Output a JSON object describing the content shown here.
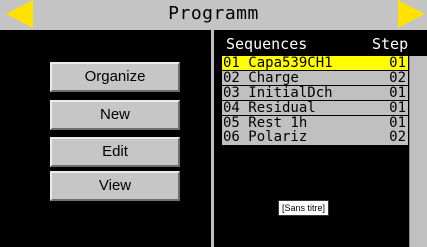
{
  "titlebar": {
    "title": "Programm",
    "prev_icon": "triangle-left-icon",
    "next_icon": "triangle-right-icon",
    "accent_color": "#ffe200"
  },
  "menu": {
    "organize_label": "Organize",
    "new_label": "New",
    "edit_label": "Edit",
    "view_label": "View"
  },
  "sequences": {
    "header_sequences": "Sequences",
    "header_step": "Step",
    "selected_color": "#ffff00",
    "rows": [
      {
        "label": "01 Capa539CH1",
        "step": "01"
      },
      {
        "label": "02 Charge",
        "step": "02"
      },
      {
        "label": "03 InitialDch",
        "step": "01"
      },
      {
        "label": "04 Residual",
        "step": "01"
      },
      {
        "label": "05 Rest 1h",
        "step": "01"
      },
      {
        "label": "06 Polariz",
        "step": "02"
      }
    ]
  },
  "tooltip": {
    "text": "[Sans titre]"
  }
}
